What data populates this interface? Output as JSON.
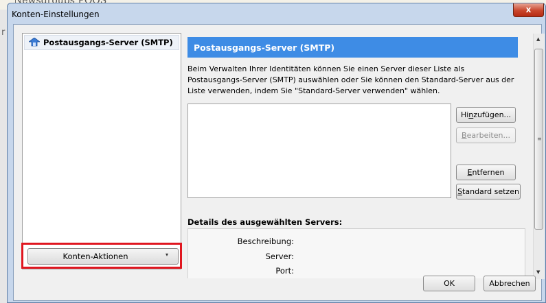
{
  "background": {
    "partial_text": "Newsgroups   POOS",
    "edge_char": "r"
  },
  "window": {
    "title": "Konten-Einstellungen",
    "close_label": "x"
  },
  "sidebar": {
    "items": [
      {
        "label": "Postausgangs-Server (SMTP)",
        "icon": "server-icon",
        "selected": true
      }
    ],
    "actions_button": {
      "label": "Konten-Aktionen",
      "arrow": "▾"
    }
  },
  "main": {
    "header_title": "Postausgangs-Server (SMTP)",
    "description": "Beim Verwalten Ihrer Identitäten können Sie einen Server dieser Liste als Postausgangs-Server (SMTP) auswählen oder Sie können den Standard-Server aus der Liste verwenden, indem Sie \"Standard-Server verwenden\" wählen.",
    "buttons": {
      "add": {
        "pre": "Hi",
        "mn": "n",
        "post": "zufügen..."
      },
      "edit": {
        "pre": "",
        "mn": "B",
        "post": "earbeiten..."
      },
      "remove": {
        "pre": "",
        "mn": "E",
        "post": "ntfernen"
      },
      "set_default": {
        "pre": "",
        "mn": "S",
        "post": "tandard setzen"
      }
    },
    "details": {
      "label": "Details des ausgewählten Servers:",
      "fields": [
        {
          "label": "Beschreibung:"
        },
        {
          "label": "Server:"
        },
        {
          "label": "Port:"
        }
      ]
    }
  },
  "dialog_buttons": {
    "ok": "OK",
    "cancel": "Abbrechen"
  },
  "colors": {
    "header_bg": "#3e8ce5",
    "highlight": "#e0161f",
    "close_button": "#c9462c"
  }
}
